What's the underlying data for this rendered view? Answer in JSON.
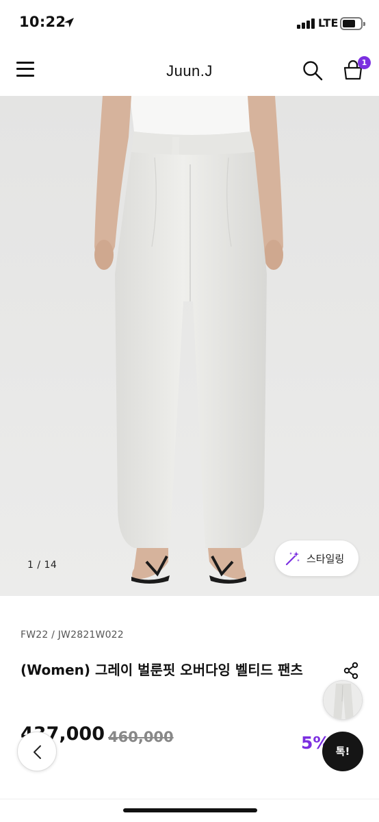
{
  "status_bar": {
    "time": "10:22",
    "network": "LTE"
  },
  "header": {
    "brand": "Juun.J",
    "cart_count": "1",
    "icons": [
      "hamburger-menu-icon",
      "search-icon",
      "shopping-bag-icon"
    ]
  },
  "gallery": {
    "counter": "1  /  14",
    "styling_label": "스타일링"
  },
  "product": {
    "sku": "FW22 / JW2821W022",
    "title": "(Women) 그레이 벌룬핏 오버다잉 벨티드 팬츠",
    "price": "437,000",
    "original_price": "460,000",
    "discount": "5%"
  },
  "floating": {
    "chat_label": "톡!"
  },
  "colors": {
    "accent": "#7b2fe0",
    "image_bg": "#e7e7e6"
  }
}
